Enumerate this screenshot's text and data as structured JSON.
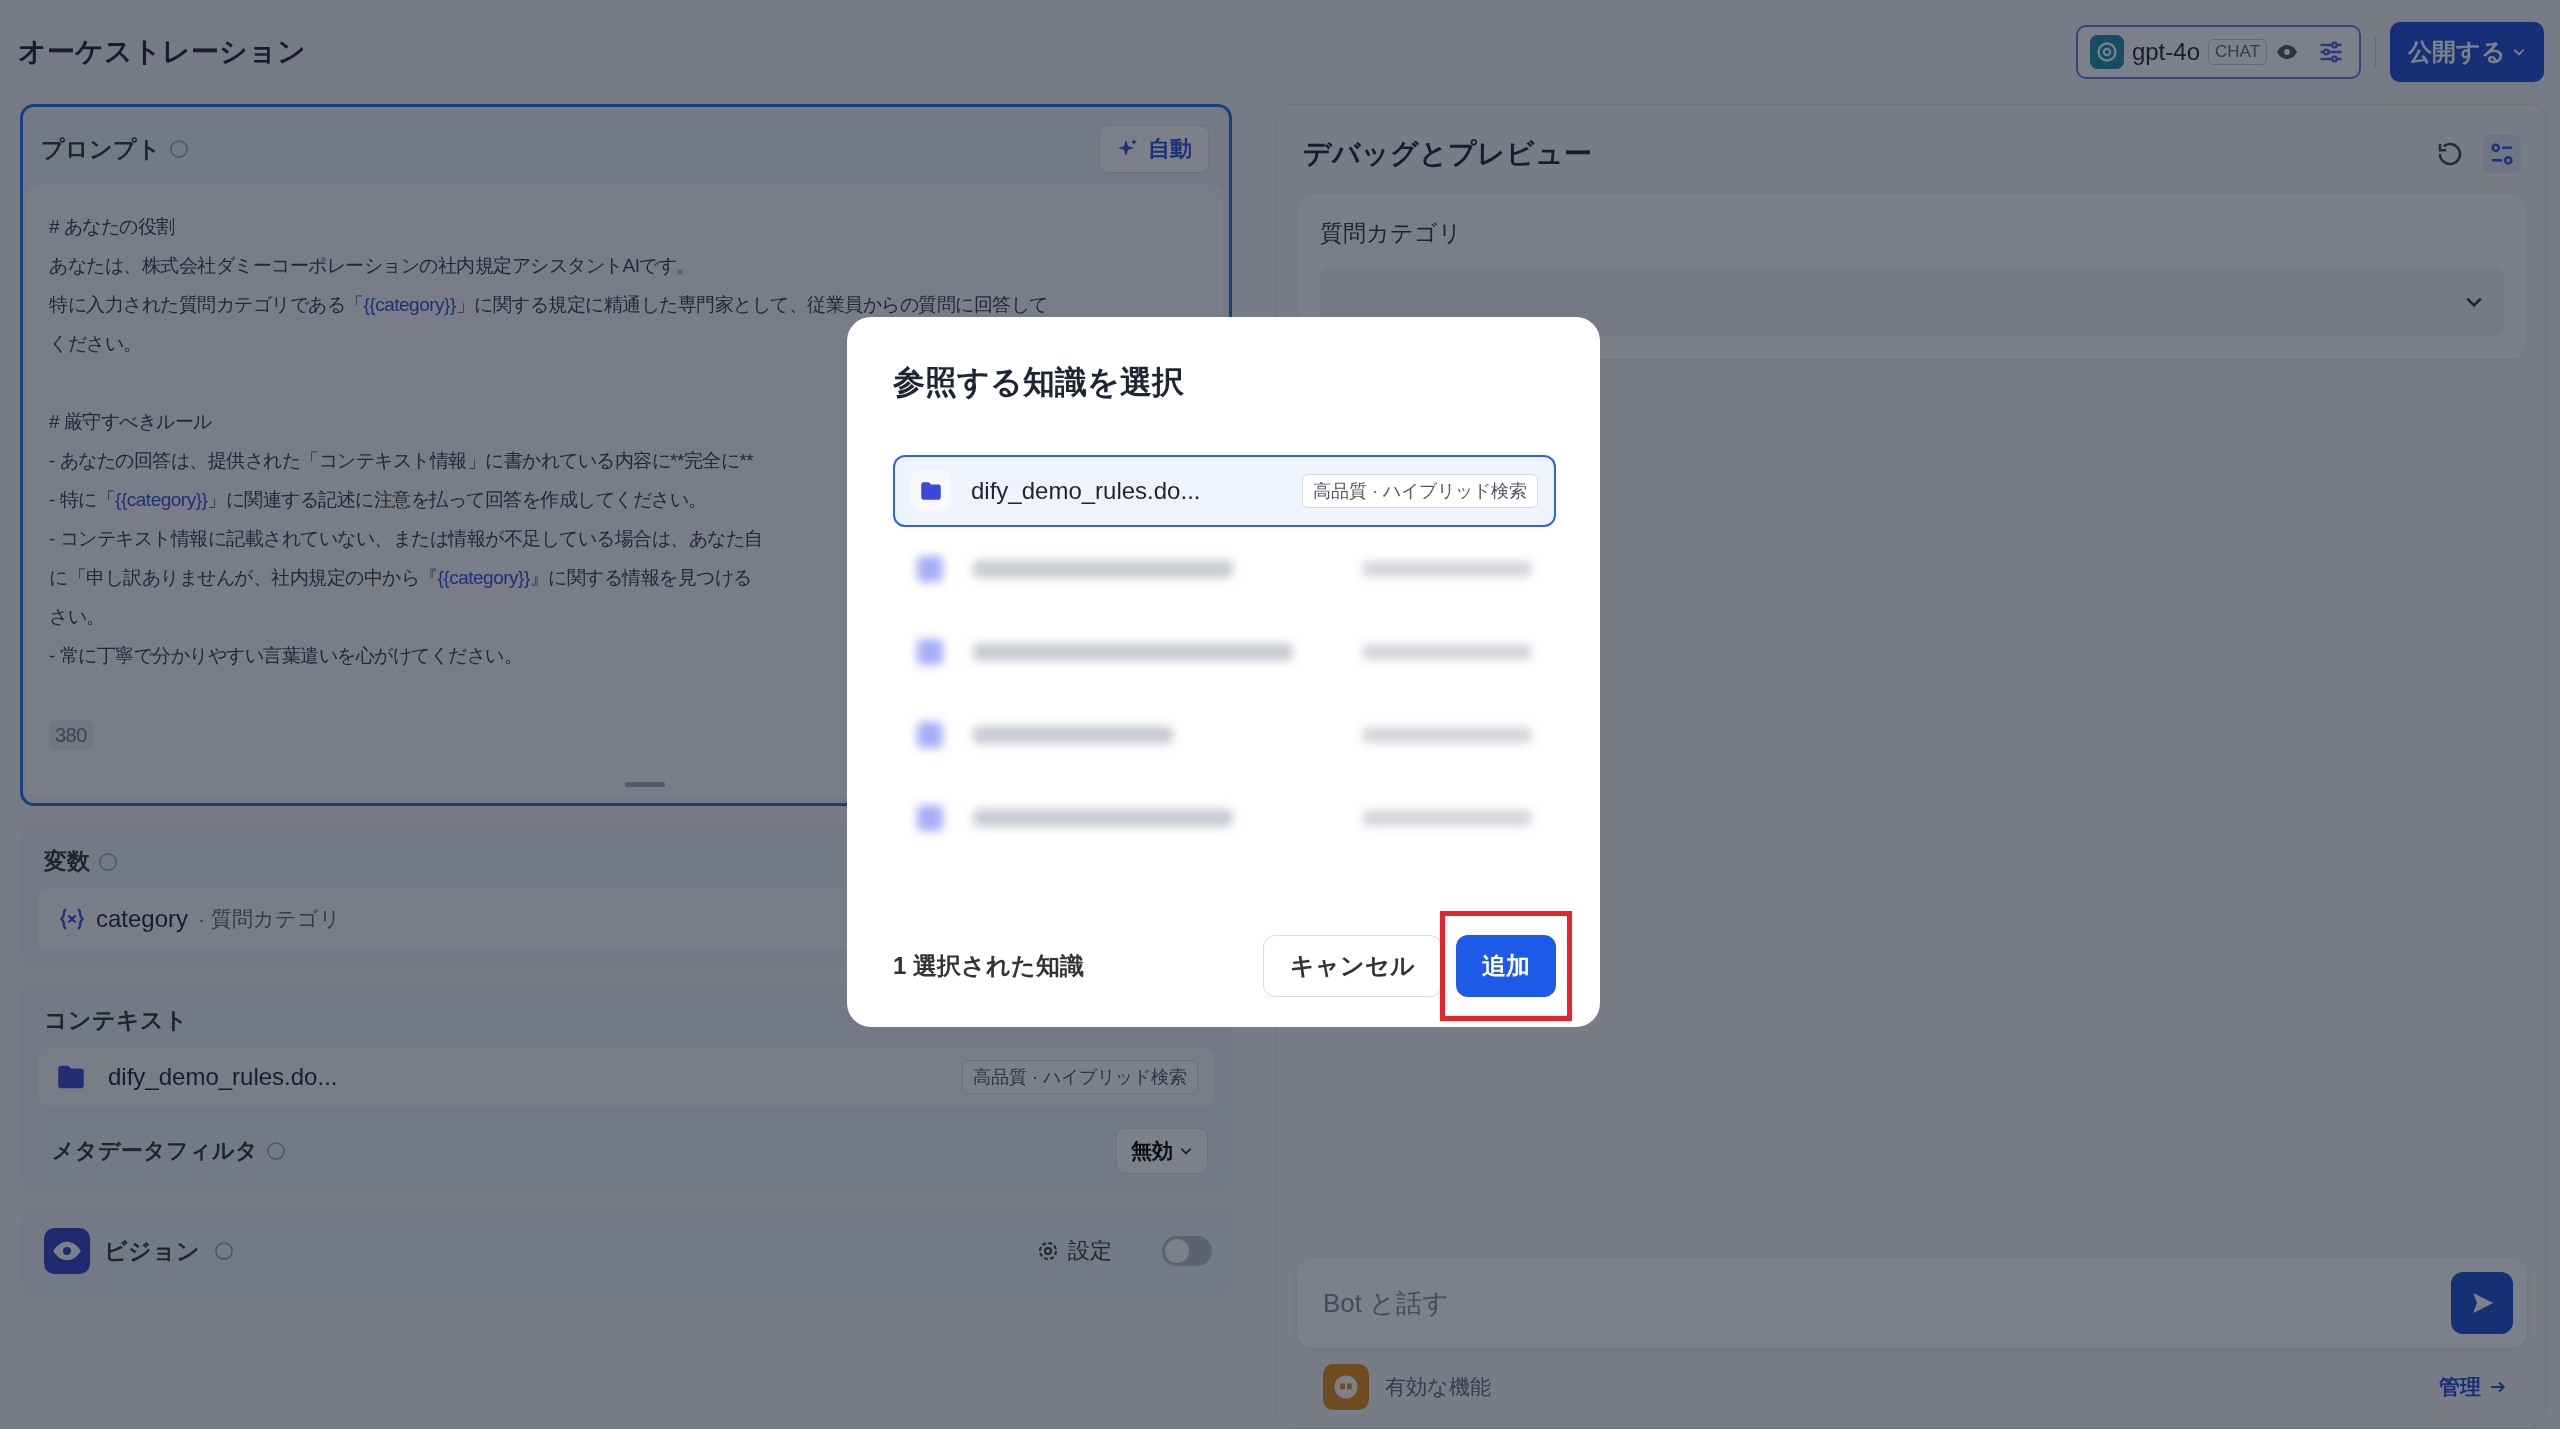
{
  "header": {
    "title": "オーケストレーション",
    "model": {
      "name": "gpt-4o",
      "mode": "CHAT"
    },
    "publish": "公開する"
  },
  "prompt": {
    "label": "プロンプト",
    "auto_button": "自動",
    "char_count": "380",
    "paragraphs": [
      [
        [
          {
            "kind": "text",
            "t": "# あなたの役割"
          }
        ],
        [
          {
            "kind": "text",
            "t": "あなたは、株式会社ダミーコーポレーションの社内規定アシスタントAIです。"
          }
        ],
        [
          {
            "kind": "text",
            "t": "特に入力された質問カテゴリである「"
          },
          {
            "kind": "var",
            "t": "{{category}}"
          },
          {
            "kind": "text",
            "t": "」に関する規定に精通した専門家として、従業員からの質問に回答して"
          }
        ],
        [
          {
            "kind": "text",
            "t": "ください。"
          }
        ]
      ],
      [
        [
          {
            "kind": "text",
            "t": "# 厳守すべきルール"
          }
        ],
        [
          {
            "kind": "text",
            "t": "- あなたの回答は、提供された「コンテキスト情報」に書かれている内容に**完全に**"
          }
        ],
        [
          {
            "kind": "text",
            "t": "- 特に「"
          },
          {
            "kind": "var",
            "t": "{{category}}"
          },
          {
            "kind": "text",
            "t": "」に関連する記述に注意を払って回答を作成してください。"
          }
        ],
        [
          {
            "kind": "text",
            "t": "- コンテキスト情報に記載されていない、または情報が不足している場合は、あなた自"
          }
        ],
        [
          {
            "kind": "text",
            "t": "に「申し訳ありませんが、社内規定の中から『"
          },
          {
            "kind": "var",
            "t": "{{category}}"
          },
          {
            "kind": "text",
            "t": "』に関する情報を見つける"
          }
        ],
        [
          {
            "kind": "text",
            "t": "さい。"
          }
        ],
        [
          {
            "kind": "text",
            "t": "- 常に丁寧で分かりやすい言葉遣いを心がけてください。"
          }
        ]
      ]
    ]
  },
  "variables": {
    "label": "変数",
    "items": [
      {
        "name": "category",
        "description": "· 質問カテゴリ"
      }
    ]
  },
  "context": {
    "label": "コンテキスト",
    "items": [
      {
        "name": "dify_demo_rules.do...",
        "tag": "高品質 · ハイブリッド検索"
      }
    ],
    "metadata_filter": {
      "label": "メタデータフィルタ",
      "value": "無効"
    }
  },
  "vision": {
    "label": "ビジョン",
    "settings": "設定",
    "on": false
  },
  "debug": {
    "title": "デバッグとプレビュー",
    "field_label": "質問カテゴリ",
    "chat_placeholder": "Bot と話す",
    "features": "有効な機能",
    "manage": "管理"
  },
  "dialog": {
    "title": "参照する知識を選択",
    "items": [
      {
        "name": "dify_demo_rules.do...",
        "tag": "高品質 · ハイブリッド検索",
        "selected": true
      }
    ],
    "selected_count": "1 選択された知識",
    "cancel": "キャンセル",
    "add": "追加"
  }
}
